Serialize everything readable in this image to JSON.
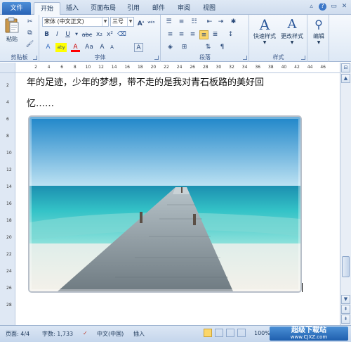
{
  "tabs": {
    "file": "文件",
    "home": "开始",
    "insert": "插入",
    "layout": "页面布局",
    "references": "引用",
    "mailings": "邮件",
    "review": "审阅",
    "view": "视图"
  },
  "clipboard": {
    "paste": "粘贴",
    "label": "剪贴板"
  },
  "font": {
    "name": "宋体 (中文正文)",
    "size": "三号",
    "wen": "wén",
    "label": "字体",
    "bold": "B",
    "italic": "I",
    "underline": "U",
    "strike": "abc",
    "sub": "x₂",
    "sup": "x²",
    "grow": "A",
    "shrink": "A",
    "case": "Aa",
    "clear": "A",
    "highlight": "aby",
    "color": "A"
  },
  "paragraph": {
    "label": "段落"
  },
  "styles": {
    "quick": "快速样式",
    "change": "更改样式",
    "label": "样式"
  },
  "editing": {
    "label": "编辑"
  },
  "ruler": {
    "numbers": [
      "2",
      "4",
      "6",
      "8",
      "10",
      "12",
      "14",
      "16",
      "18",
      "20",
      "22",
      "24",
      "26",
      "28",
      "30",
      "32",
      "34",
      "36",
      "38",
      "40",
      "42",
      "44",
      "46"
    ]
  },
  "vruler": {
    "numbers": [
      "2",
      "4",
      "6",
      "8",
      "10",
      "12",
      "14",
      "16",
      "18",
      "20",
      "22",
      "24",
      "26",
      "28"
    ]
  },
  "document": {
    "line1": "年的足迹，少年的梦想，带不走的是我对青石板路的美好回",
    "line2": "忆……"
  },
  "status": {
    "page": "页面: 4/4",
    "words": "字数: 1,733",
    "lang": "中文(中国)",
    "mode": "插入",
    "zoom": "100%"
  },
  "watermark": {
    "title": "超级下载站",
    "url": "www.CJXZ.com"
  },
  "colors": {
    "accent": "#2b579a",
    "highlight": "#ffff00",
    "font_color": "#ff0000"
  }
}
